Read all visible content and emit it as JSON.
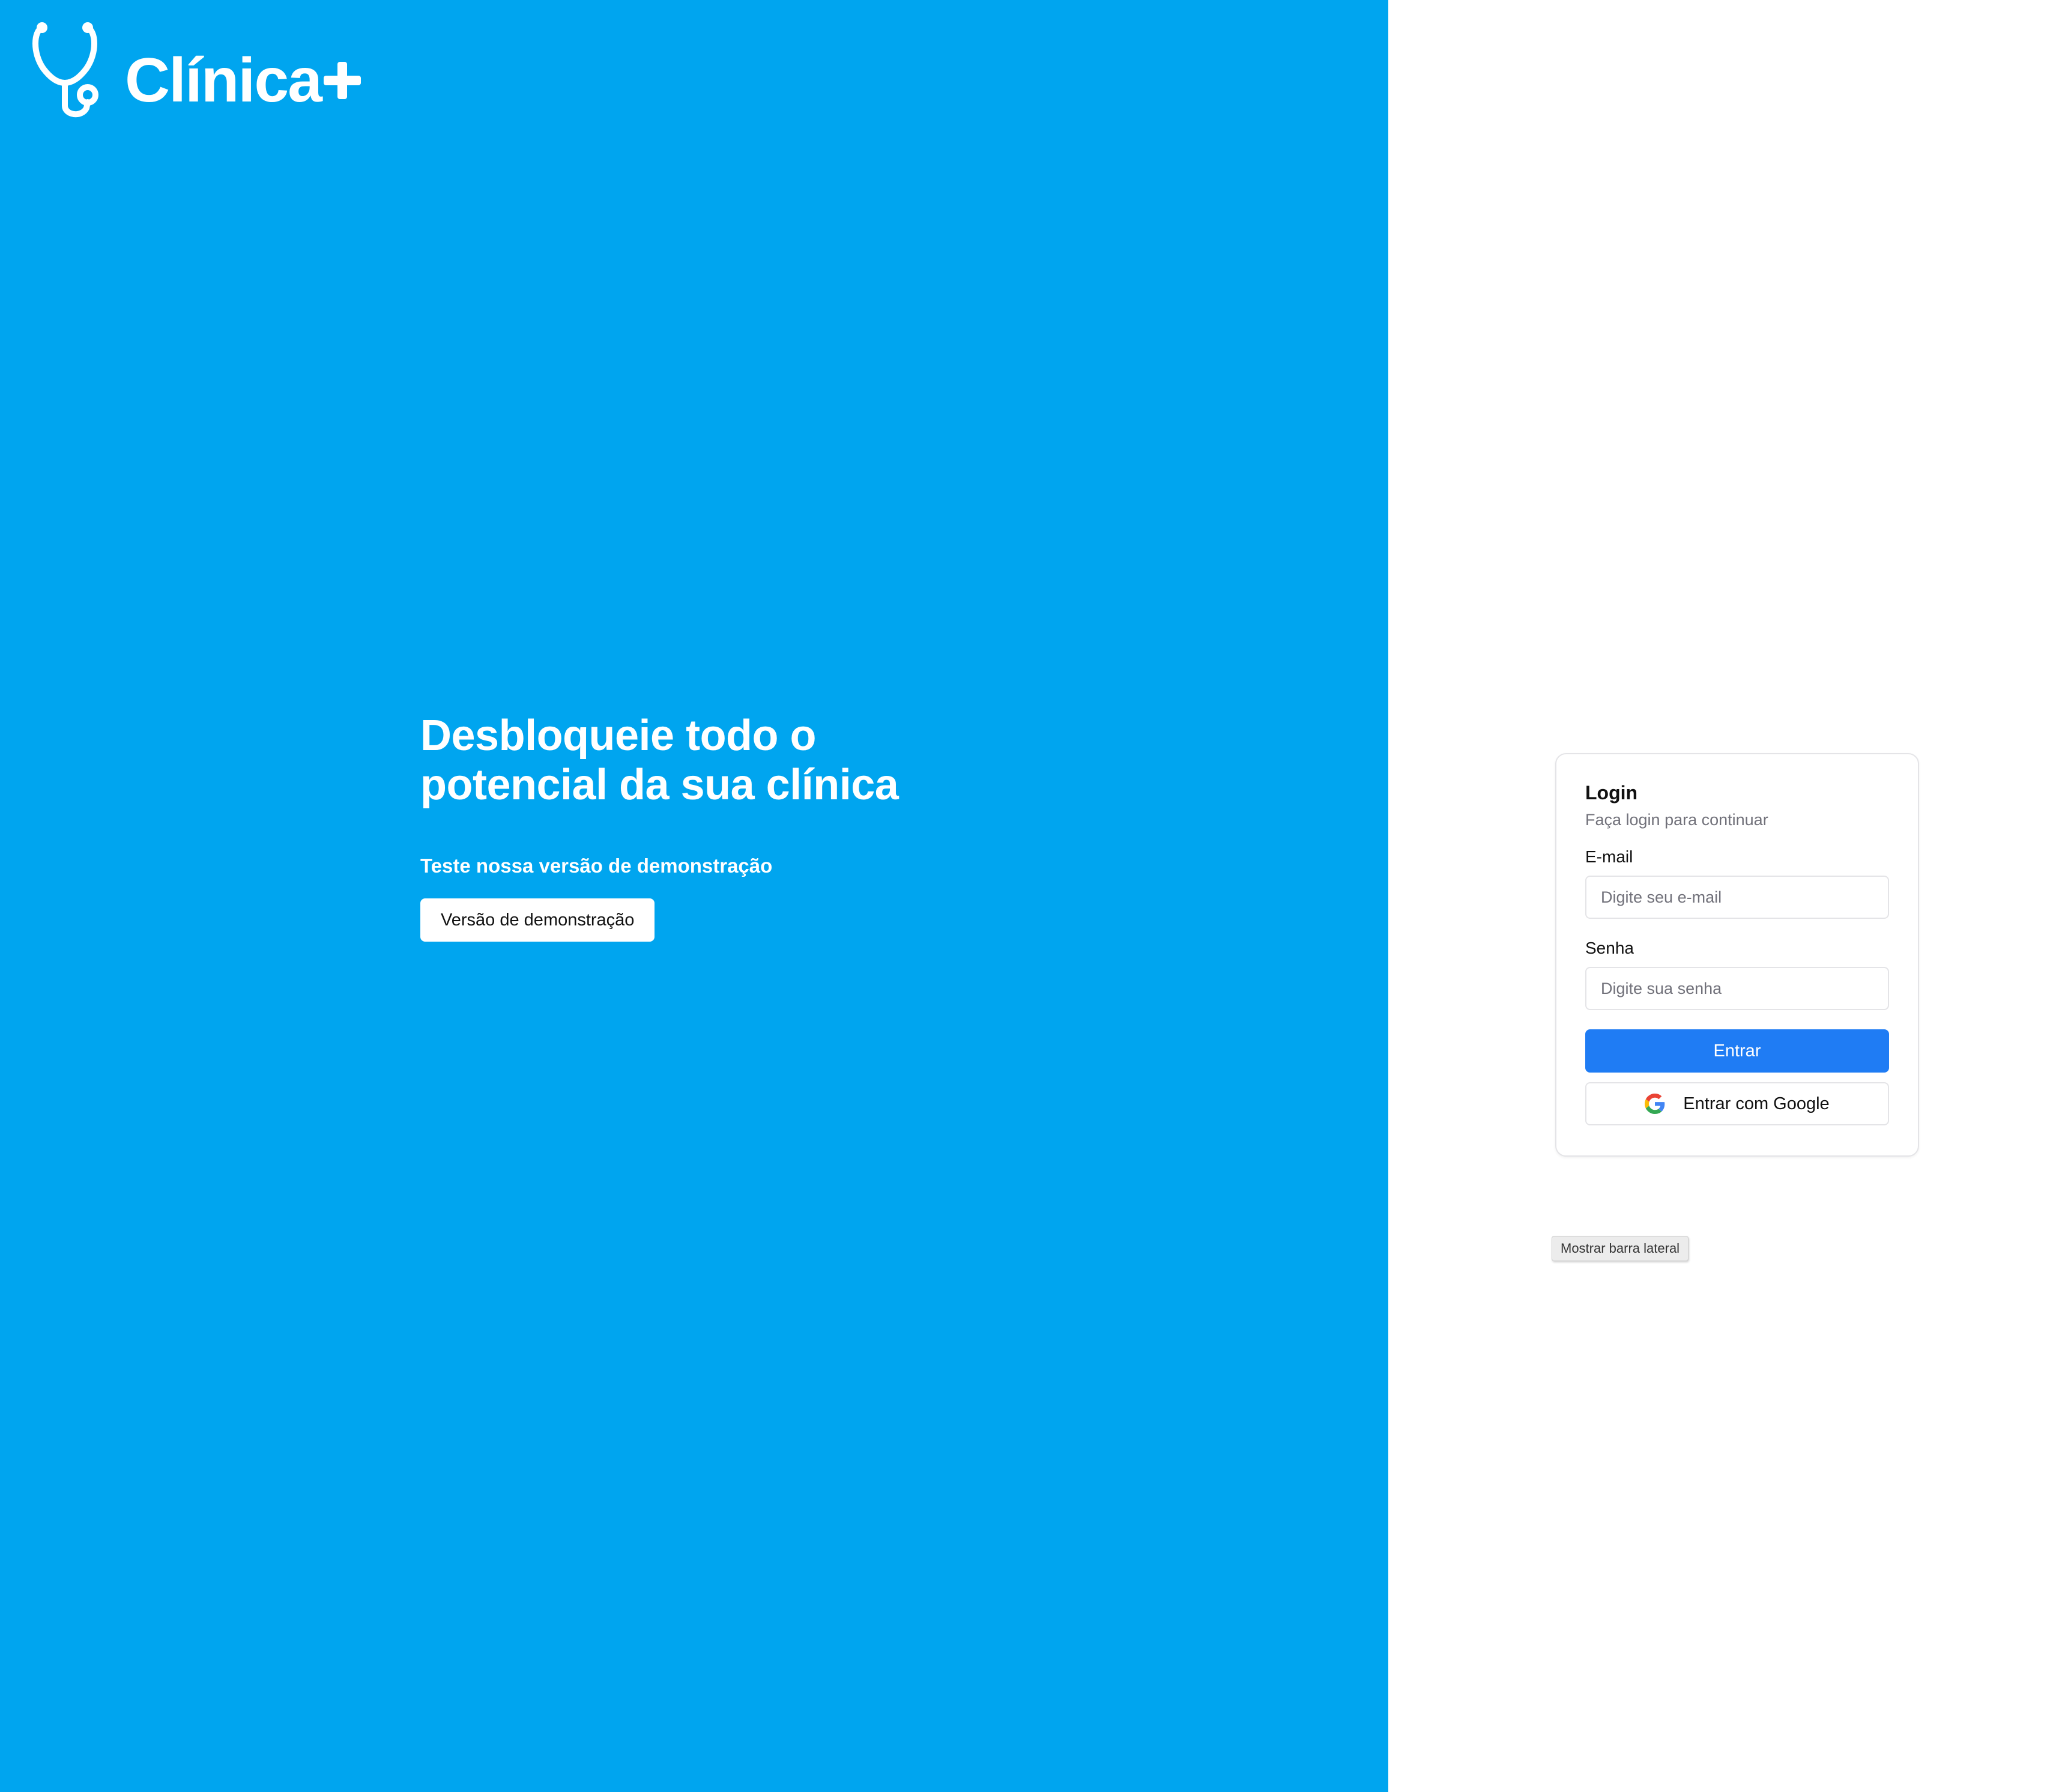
{
  "brand": {
    "name": "Clínica",
    "logo_icon": "stethoscope-icon",
    "plus_icon": "plus-icon"
  },
  "hero": {
    "title_line1": "Desbloqueie todo o",
    "title_line2": "potencial da sua clínica",
    "subtitle": "Teste nossa versão de demonstração",
    "demo_button": "Versão de demonstração"
  },
  "login": {
    "title": "Login",
    "description": "Faça login para continuar",
    "email_label": "E-mail",
    "email_placeholder": "Digite seu e-mail",
    "email_value": "",
    "password_label": "Senha",
    "password_placeholder": "Digite sua senha",
    "password_value": "",
    "submit_label": "Entrar",
    "google_label": "Entrar com Google",
    "google_icon": "google-icon"
  },
  "tooltip": {
    "text": "Mostrar barra lateral"
  },
  "colors": {
    "hero_background": "#00a5ef",
    "primary_button": "#1f7cf4",
    "page_background": "#ffffff",
    "muted_text": "#71717a",
    "border": "#e4e4e7"
  }
}
